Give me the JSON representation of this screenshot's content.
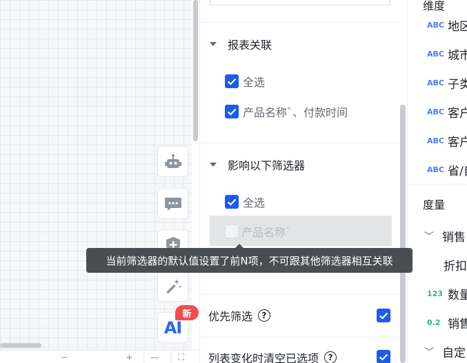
{
  "report_link": {
    "title": "报表关联",
    "items": [
      {
        "label": "全选",
        "checked": true
      },
      {
        "label": "产品名称`、付款时间",
        "checked": true
      }
    ]
  },
  "affect_filters": {
    "title": "影响以下筛选器",
    "items": [
      {
        "label": "全选",
        "checked": true
      },
      {
        "label": "产品名称`",
        "checked": false,
        "disabled": true
      }
    ]
  },
  "tooltip": {
    "text": "当前筛选器的默认值设置了前N项，不可跟其他筛选器相互关联"
  },
  "options": {
    "priority_filter": {
      "label": "优先筛选",
      "checked": true
    },
    "clear_on_change": {
      "label": "列表变化时清空已选项",
      "checked": true
    },
    "help_icon_glyph": "?"
  },
  "tools": {
    "ai_label": "AI",
    "new_badge": "新"
  },
  "fields": {
    "dimension_header": "维度",
    "dimensions": [
      {
        "type": "ABC",
        "name": "地区"
      },
      {
        "type": "ABC",
        "name": "城市"
      },
      {
        "type": "ABC",
        "name": "子类"
      },
      {
        "type": "ABC",
        "name": "客户"
      },
      {
        "type": "ABC",
        "name": "客户"
      },
      {
        "type": "ABC",
        "name": "省/自"
      }
    ],
    "measure_header": "度量",
    "measures": [
      {
        "type": "chevron",
        "name": "销售"
      },
      {
        "type": "",
        "name": "折扣"
      },
      {
        "type": "123",
        "name": "数量"
      },
      {
        "type": "0.2",
        "name": "销售"
      },
      {
        "type": "chevron",
        "name": "自定"
      }
    ]
  },
  "colors": {
    "accent": "#1a5cf0",
    "tooltip_bg": "#4a4d52",
    "badge_red": "#f04e4e",
    "ai_blue": "#2a68f5"
  }
}
